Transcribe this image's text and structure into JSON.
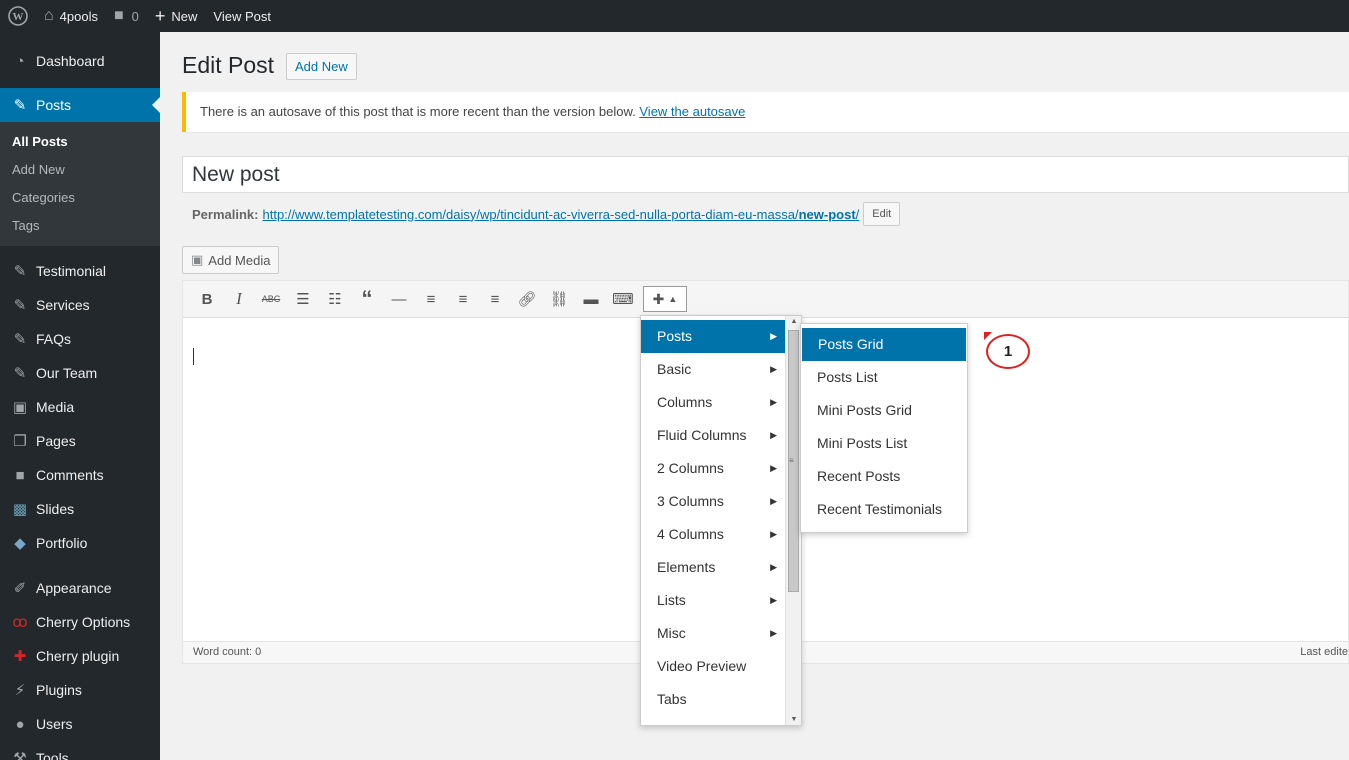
{
  "adminbar": {
    "site_name": "4pools",
    "comments_count": "0",
    "new_label": "New",
    "view_post_label": "View Post"
  },
  "sidebar": {
    "items": [
      {
        "label": "Dashboard",
        "icon": "dashboard-icon"
      },
      {
        "label": "Posts",
        "icon": "pin-icon"
      },
      {
        "label": "Testimonial",
        "icon": "pin-icon"
      },
      {
        "label": "Services",
        "icon": "pin-icon"
      },
      {
        "label": "FAQs",
        "icon": "pin-icon"
      },
      {
        "label": "Our Team",
        "icon": "pin-icon"
      },
      {
        "label": "Media",
        "icon": "media-icon"
      },
      {
        "label": "Pages",
        "icon": "pages-icon"
      },
      {
        "label": "Comments",
        "icon": "comments-icon"
      },
      {
        "label": "Slides",
        "icon": "slides-icon"
      },
      {
        "label": "Portfolio",
        "icon": "portfolio-icon"
      },
      {
        "label": "Appearance",
        "icon": "appearance-icon"
      },
      {
        "label": "Cherry Options",
        "icon": "cherry-icon"
      },
      {
        "label": "Cherry plugin",
        "icon": "puzzle-icon"
      },
      {
        "label": "Plugins",
        "icon": "plugins-icon"
      },
      {
        "label": "Users",
        "icon": "users-icon"
      },
      {
        "label": "Tools",
        "icon": "tools-icon"
      }
    ],
    "posts_submenu": [
      "All Posts",
      "Add New",
      "Categories",
      "Tags"
    ]
  },
  "main": {
    "page_title": "Edit Post",
    "add_new_label": "Add New",
    "notice_text": "There is an autosave of this post that is more recent than the version below.",
    "notice_link": "View the autosave",
    "post_title": "New post",
    "permalink_label": "Permalink:",
    "permalink_url_base": "http://www.templatetesting.com/daisy/wp/tincidunt-ac-viverra-sed-nulla-porta-diam-eu-massa/",
    "permalink_slug": "new-post",
    "permalink_trailing": "/",
    "edit_label": "Edit",
    "add_media_label": "Add Media",
    "word_count": "Word count: 0",
    "last_edited": "Last edite"
  },
  "shortcode_menu": {
    "items": [
      {
        "label": "Posts",
        "has_sub": true
      },
      {
        "label": "Basic",
        "has_sub": true
      },
      {
        "label": "Columns",
        "has_sub": true
      },
      {
        "label": "Fluid Columns",
        "has_sub": true
      },
      {
        "label": "2 Columns",
        "has_sub": true
      },
      {
        "label": "3 Columns",
        "has_sub": true
      },
      {
        "label": "4 Columns",
        "has_sub": true
      },
      {
        "label": "Elements",
        "has_sub": true
      },
      {
        "label": "Lists",
        "has_sub": true
      },
      {
        "label": "Misc",
        "has_sub": true
      },
      {
        "label": "Video Preview",
        "has_sub": false
      },
      {
        "label": "Tabs",
        "has_sub": false
      }
    ],
    "posts_submenu": [
      "Posts Grid",
      "Posts List",
      "Mini Posts Grid",
      "Mini Posts List",
      "Recent Posts",
      "Recent Testimonials"
    ]
  },
  "annotation": {
    "number": "1"
  },
  "colors": {
    "accent": "#0073aa",
    "adminbar": "#23282d",
    "notice": "#ffb900",
    "callout": "#e02020"
  }
}
